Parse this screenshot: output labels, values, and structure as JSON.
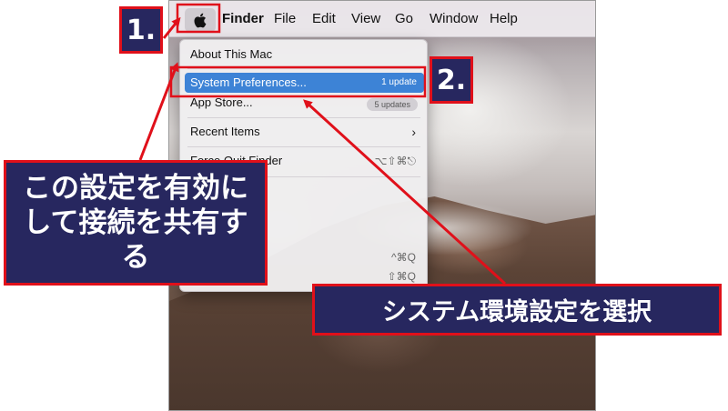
{
  "menubar": {
    "app_name": "Finder",
    "items": [
      "File",
      "Edit",
      "View",
      "Go",
      "Window",
      "Help"
    ]
  },
  "apple_menu": {
    "about": "About This Mac",
    "system_preferences": "System Preferences...",
    "system_preferences_badge": "1 update",
    "app_store": "App Store...",
    "app_store_badge": "5 updates",
    "recent_items": "Recent Items",
    "force_quit": "Force Quit Finder",
    "force_quit_shortcut": "⌥⇧⌘⎋",
    "shortcut_1": "^⌘Q",
    "shortcut_2": "⇧⌘Q"
  },
  "annotations": {
    "step1": "1.",
    "step2": "2.",
    "note_line1": "この設定を有効に",
    "note_line2": "して接続を共有す",
    "note_line3": "る",
    "select_system_prefs": "システム環境設定を選択"
  },
  "colors": {
    "callout_bg": "#27275f",
    "callout_border": "#e0101a",
    "arrow": "#e0101a",
    "menu_highlight": "#3d83d6"
  }
}
